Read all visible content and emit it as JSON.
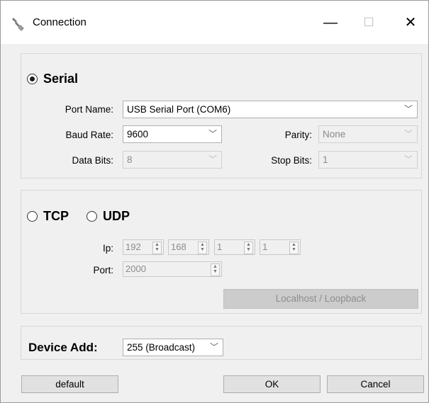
{
  "window": {
    "title": "Connection",
    "minimize_glyph": "—",
    "maximize_glyph": "☐",
    "close_glyph": "✕"
  },
  "serial": {
    "label": "Serial",
    "selected": true,
    "port_name_label": "Port Name:",
    "port_name_value": "USB Serial Port (COM6)",
    "baud_rate_label": "Baud Rate:",
    "baud_rate_value": "9600",
    "parity_label": "Parity:",
    "parity_value": "None",
    "data_bits_label": "Data Bits:",
    "data_bits_value": "8",
    "stop_bits_label": "Stop Bits:",
    "stop_bits_value": "1"
  },
  "network": {
    "tcp_label": "TCP",
    "udp_label": "UDP",
    "ip_label": "Ip:",
    "ip_octets": [
      "192",
      "168",
      "1",
      "1"
    ],
    "port_label": "Port:",
    "port_value": "2000",
    "loopback_button": "Localhost / Loopback"
  },
  "device": {
    "label": "Device Add:",
    "value": "255 (Broadcast)"
  },
  "buttons": {
    "default": "default",
    "ok": "OK",
    "cancel": "Cancel"
  },
  "glyphs": {
    "dropdown": "﹀",
    "spin_up": "▲",
    "spin_down": "▼"
  },
  "icons": {
    "app_icon": "wrench-icon"
  }
}
